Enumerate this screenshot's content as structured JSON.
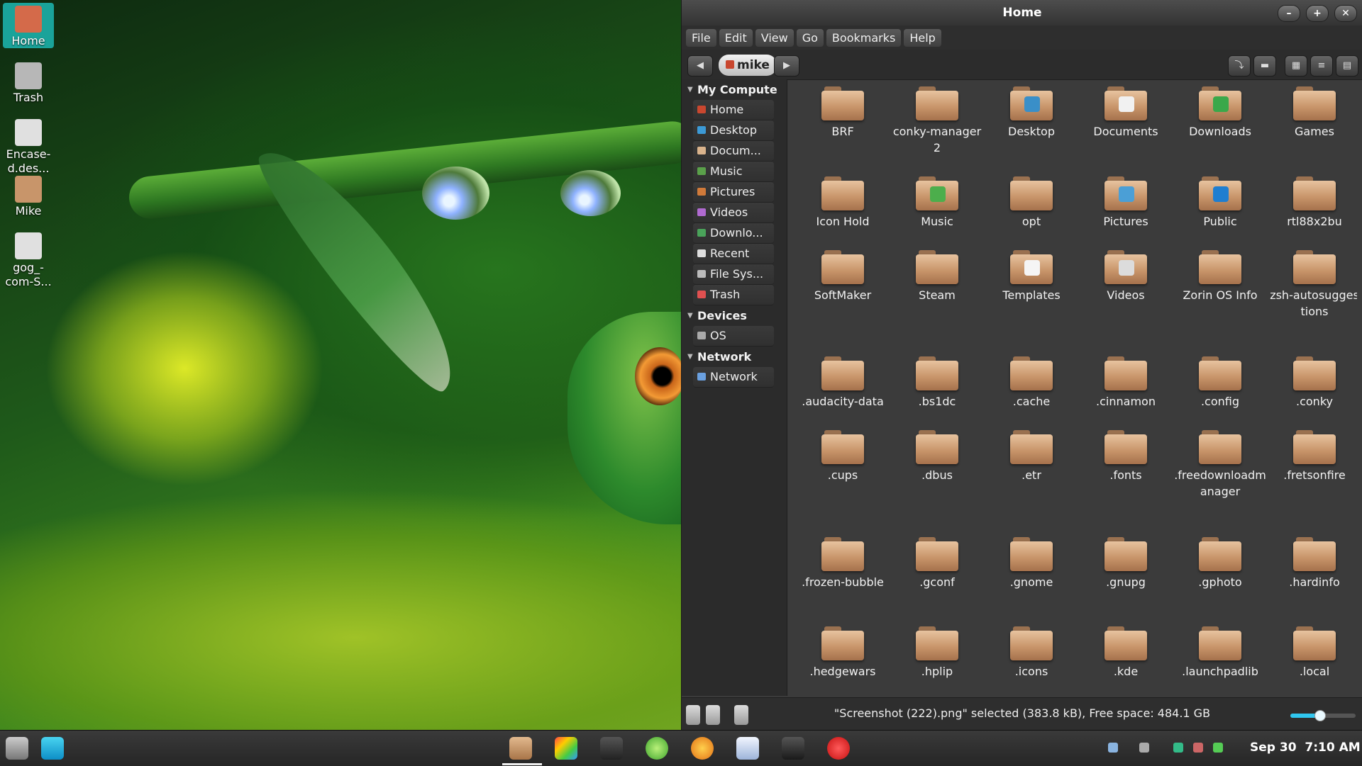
{
  "desktop": {
    "icons": [
      {
        "label": "Home"
      },
      {
        "label": "Trash"
      },
      {
        "label": "Encase-d.des..."
      },
      {
        "label": "Mike"
      },
      {
        "label": "gog_-com-S..."
      }
    ]
  },
  "window": {
    "title": "Home",
    "menu": [
      "File",
      "Edit",
      "View",
      "Go",
      "Bookmarks",
      "Help"
    ],
    "breadcrumb": "mike",
    "sidebar": {
      "sections": [
        {
          "title": "My Compute",
          "items": [
            "Home",
            "Desktop",
            "Docum...",
            "Music",
            "Pictures",
            "Videos",
            "Downlo...",
            "Recent",
            "File Sys...",
            "Trash"
          ]
        },
        {
          "title": "Devices",
          "items": [
            "OS"
          ]
        },
        {
          "title": "Network",
          "items": [
            "Network"
          ]
        }
      ]
    },
    "files": [
      {
        "name": "BRF"
      },
      {
        "name": "conky-manager2"
      },
      {
        "name": "Desktop"
      },
      {
        "name": "Documents"
      },
      {
        "name": "Downloads"
      },
      {
        "name": "Games"
      },
      {
        "name": "Icon Hold"
      },
      {
        "name": "Music"
      },
      {
        "name": "opt"
      },
      {
        "name": "Pictures"
      },
      {
        "name": "Public"
      },
      {
        "name": "rtl88x2bu"
      },
      {
        "name": "SoftMaker"
      },
      {
        "name": "Steam"
      },
      {
        "name": "Templates"
      },
      {
        "name": "Videos"
      },
      {
        "name": "Zorin OS Info"
      },
      {
        "name": "zsh-autosuggestions"
      },
      {
        "name": ".audacity-data"
      },
      {
        "name": ".bs1dc"
      },
      {
        "name": ".cache"
      },
      {
        "name": ".cinnamon"
      },
      {
        "name": ".config"
      },
      {
        "name": ".conky"
      },
      {
        "name": ".cups"
      },
      {
        "name": ".dbus"
      },
      {
        "name": ".etr"
      },
      {
        "name": ".fonts"
      },
      {
        "name": ".freedownloadmanager"
      },
      {
        "name": ".fretsonfire"
      },
      {
        "name": ".frozen-bubble"
      },
      {
        "name": ".gconf"
      },
      {
        "name": ".gnome"
      },
      {
        "name": ".gnupg"
      },
      {
        "name": ".gphoto"
      },
      {
        "name": ".hardinfo"
      },
      {
        "name": ".hedgewars"
      },
      {
        "name": ".hplip"
      },
      {
        "name": ".icons"
      },
      {
        "name": ".kde"
      },
      {
        "name": ".launchpadlib"
      },
      {
        "name": ".local"
      }
    ],
    "status": "\"Screenshot (222).png\" selected (383.8 kB), Free space: 484.1 GB",
    "zoom_level": 0.45
  },
  "panel": {
    "date": "Sep 30",
    "time": "7:10 AM"
  },
  "colors": {
    "selection": "#1aa39a",
    "folder": "#c8956a",
    "window_bg": "#3b3b3b",
    "zoom_accent": "#30c7f0"
  }
}
